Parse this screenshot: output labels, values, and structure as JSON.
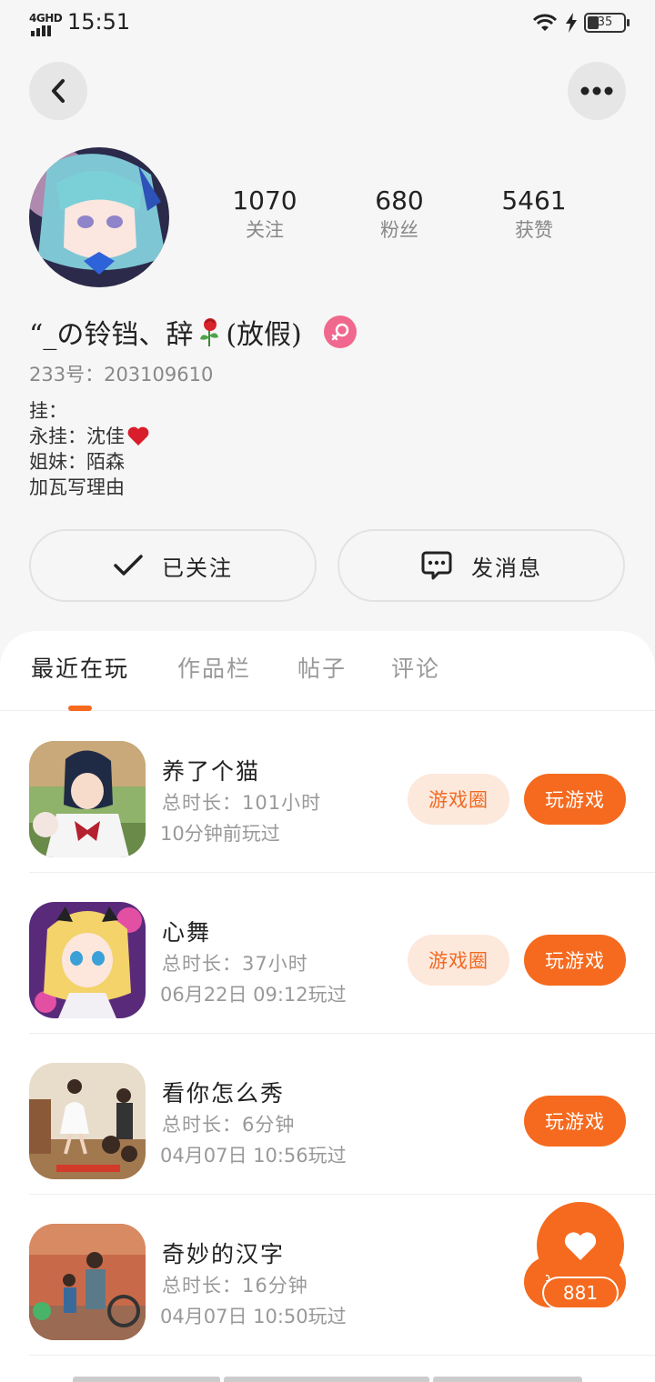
{
  "status_bar": {
    "network": "4GHD",
    "time": "15:51",
    "battery": "35"
  },
  "profile": {
    "stats": [
      {
        "value": "1070",
        "label": "关注"
      },
      {
        "value": "680",
        "label": "粉丝"
      },
      {
        "value": "5461",
        "label": "获赞"
      }
    ],
    "nickname": "“_の铃铛、辞",
    "nickname_tail": "(放假)",
    "uid": "233号：203109610",
    "bio": {
      "line1": "挂：",
      "line2": "永挂：沈佳",
      "line3": "姐妹：陌森",
      "line4": "加瓦写理由"
    },
    "follow_label": "已关注",
    "message_label": "发消息"
  },
  "tabs": [
    {
      "label": "最近在玩",
      "active": true
    },
    {
      "label": "作品栏",
      "active": false
    },
    {
      "label": "帖子",
      "active": false
    },
    {
      "label": "评论",
      "active": false
    }
  ],
  "games": [
    {
      "name": "养了个猫",
      "duration": "总时长：101小时",
      "last_played": "10分钟前玩过",
      "circle_label": "游戏圈",
      "play_label": "玩游戏"
    },
    {
      "name": "心舞",
      "duration": "总时长：37小时",
      "last_played": "06月22日 09:12玩过",
      "circle_label": "游戏圈",
      "play_label": "玩游戏"
    },
    {
      "name": "看你怎么秀",
      "duration": "总时长：6分钟",
      "last_played": "04月07日 10:56玩过",
      "play_label": "玩游戏"
    },
    {
      "name": "奇妙的汉字",
      "duration": "总时长：16分钟",
      "last_played": "04月07日 10:50玩过",
      "play_label": "玩游戏"
    }
  ],
  "like_fab": {
    "count": "881"
  },
  "colors": {
    "accent": "#f56a1e",
    "accent_soft": "#fde8dc",
    "female": "#f0688e"
  }
}
